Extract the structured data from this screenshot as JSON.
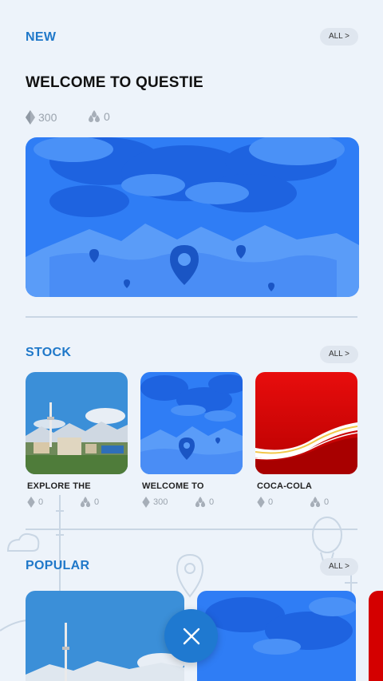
{
  "new_section": {
    "title": "NEW",
    "all_label": "ALL >",
    "quest_title": "WELCOME TO QUESTIE",
    "stat_gems": "300",
    "stat_drops": "0"
  },
  "stock_section": {
    "title": "STOCK",
    "all_label": "ALL >",
    "cards": [
      {
        "title": "EXPLORE THE",
        "gems": "0",
        "drops": "0"
      },
      {
        "title": "WELCOME TO",
        "gems": "300",
        "drops": "0"
      },
      {
        "title": "COCA-COLA",
        "gems": "0",
        "drops": "0"
      }
    ]
  },
  "popular_section": {
    "title": "POPULAR",
    "all_label": "ALL >"
  },
  "icons": {
    "gem": "gem-icon",
    "drops": "drops-icon",
    "close": "close-icon",
    "map_pin": "map-pin-icon"
  },
  "colors": {
    "accent": "#1f78c9",
    "card_blue": "#2f7df5",
    "coca_red": "#d40000",
    "background": "#edf3fa"
  }
}
